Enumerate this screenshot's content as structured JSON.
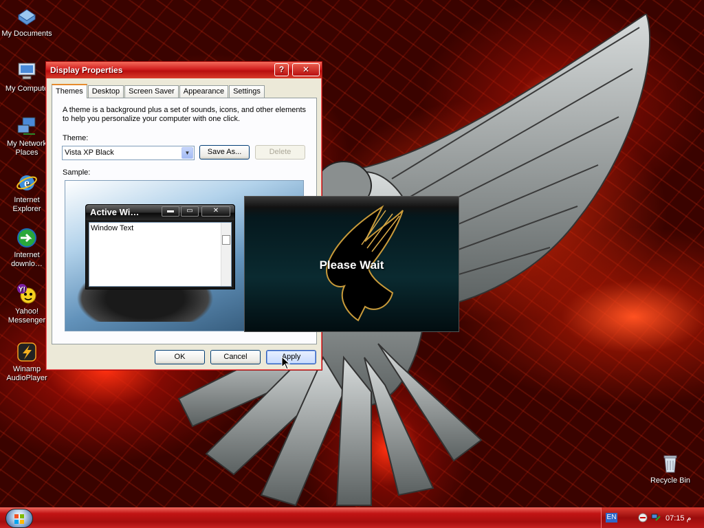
{
  "desktop": {
    "icons": [
      {
        "label": "My Documents",
        "icon": "my-documents-icon"
      },
      {
        "label": "My Compute",
        "icon": "my-computer-icon"
      },
      {
        "label": "My Network Places",
        "icon": "network-places-icon"
      },
      {
        "label": "Internet Explorer",
        "icon": "internet-explorer-icon"
      },
      {
        "label": "Internet downlo…",
        "icon": "internet-download-manager-icon"
      },
      {
        "label": "Yahoo! Messenger",
        "icon": "yahoo-messenger-icon"
      },
      {
        "label": "Winamp AudioPlayer",
        "icon": "winamp-icon"
      },
      {
        "label": "Recycle Bin",
        "icon": "recycle-bin-icon"
      }
    ]
  },
  "dialog": {
    "title": "Display Properties",
    "help_btn": "?",
    "close_btn": "✕",
    "tabs": [
      "Themes",
      "Desktop",
      "Screen Saver",
      "Appearance",
      "Settings"
    ],
    "description": "A theme is a background plus a set of sounds, icons, and other elements to help you personalize your computer with one click.",
    "theme_label": "Theme:",
    "theme_value": "Vista XP Black",
    "save_as": "Save As...",
    "delete": "Delete",
    "sample_label": "Sample:",
    "ok": "OK",
    "cancel": "Cancel",
    "apply": "Apply"
  },
  "sample_window": {
    "title": "Active Wi…",
    "min": "▬",
    "max": "▭",
    "close": "✕",
    "body_text": "Window Text"
  },
  "wait": {
    "text": "Please Wait"
  },
  "taskbar": {
    "lang": "EN",
    "clock": "07:15 م"
  }
}
